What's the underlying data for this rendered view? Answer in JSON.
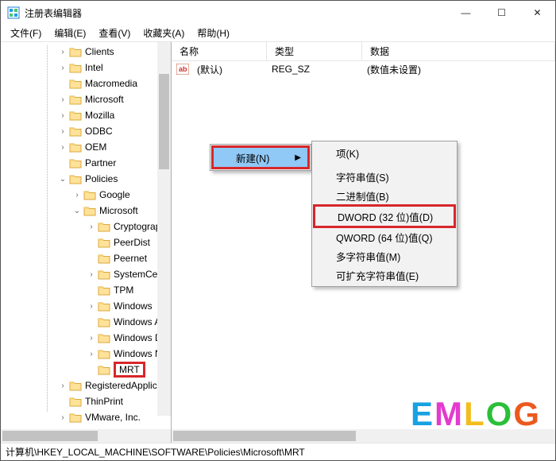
{
  "window": {
    "title": "注册表编辑器",
    "buttons": {
      "min": "—",
      "max": "☐",
      "close": "✕"
    }
  },
  "menubar": {
    "file": "文件(F)",
    "edit": "编辑(E)",
    "view": "查看(V)",
    "favorites": "收藏夹(A)",
    "help": "帮助(H)"
  },
  "tree": {
    "items": [
      {
        "level": 3,
        "exp": ">",
        "label": "Clients"
      },
      {
        "level": 3,
        "exp": ">",
        "label": "Intel"
      },
      {
        "level": 3,
        "exp": "",
        "label": "Macromedia"
      },
      {
        "level": 3,
        "exp": ">",
        "label": "Microsoft"
      },
      {
        "level": 3,
        "exp": ">",
        "label": "Mozilla"
      },
      {
        "level": 3,
        "exp": ">",
        "label": "ODBC"
      },
      {
        "level": 3,
        "exp": ">",
        "label": "OEM"
      },
      {
        "level": 3,
        "exp": "",
        "label": "Partner"
      },
      {
        "level": 3,
        "exp": "v",
        "label": "Policies"
      },
      {
        "level": 4,
        "exp": ">",
        "label": "Google"
      },
      {
        "level": 4,
        "exp": "v",
        "label": "Microsoft"
      },
      {
        "level": 5,
        "exp": ">",
        "label": "Cryptograp"
      },
      {
        "level": 5,
        "exp": "",
        "label": "PeerDist"
      },
      {
        "level": 5,
        "exp": "",
        "label": "Peernet"
      },
      {
        "level": 5,
        "exp": ">",
        "label": "SystemCert"
      },
      {
        "level": 5,
        "exp": "",
        "label": "TPM"
      },
      {
        "level": 5,
        "exp": ">",
        "label": "Windows"
      },
      {
        "level": 5,
        "exp": "",
        "label": "Windows A"
      },
      {
        "level": 5,
        "exp": ">",
        "label": "Windows D"
      },
      {
        "level": 5,
        "exp": ">",
        "label": "Windows N"
      },
      {
        "level": 5,
        "exp": "",
        "label": "MRT",
        "highlighted": true
      },
      {
        "level": 3,
        "exp": ">",
        "label": "RegisteredApplica"
      },
      {
        "level": 3,
        "exp": "",
        "label": "ThinPrint"
      },
      {
        "level": 3,
        "exp": ">",
        "label": "VMware, Inc."
      }
    ]
  },
  "list": {
    "headers": {
      "name": "名称",
      "type": "类型",
      "data": "数据"
    },
    "row_default": {
      "name": "(默认)",
      "type": "REG_SZ",
      "data": "(数值未设置)"
    }
  },
  "context": {
    "primary": {
      "new": "新建(N)"
    },
    "submenu": {
      "key": "项(K)",
      "sz": "字符串值(S)",
      "bin": "二进制值(B)",
      "dword": "DWORD (32 位)值(D)",
      "qword": "QWORD (64 位)值(Q)",
      "multi": "多字符串值(M)",
      "exp": "可扩充字符串值(E)"
    }
  },
  "statusbar": {
    "path": "计算机\\HKEY_LOCAL_MACHINE\\SOFTWARE\\Policies\\Microsoft\\MRT"
  },
  "icons": {
    "app": "regedit",
    "folder": "folder",
    "string": "ab"
  },
  "colors": {
    "highlight_red": "#d7262a",
    "selection_blue": "#90c8f6"
  },
  "watermark": "EMLOG"
}
